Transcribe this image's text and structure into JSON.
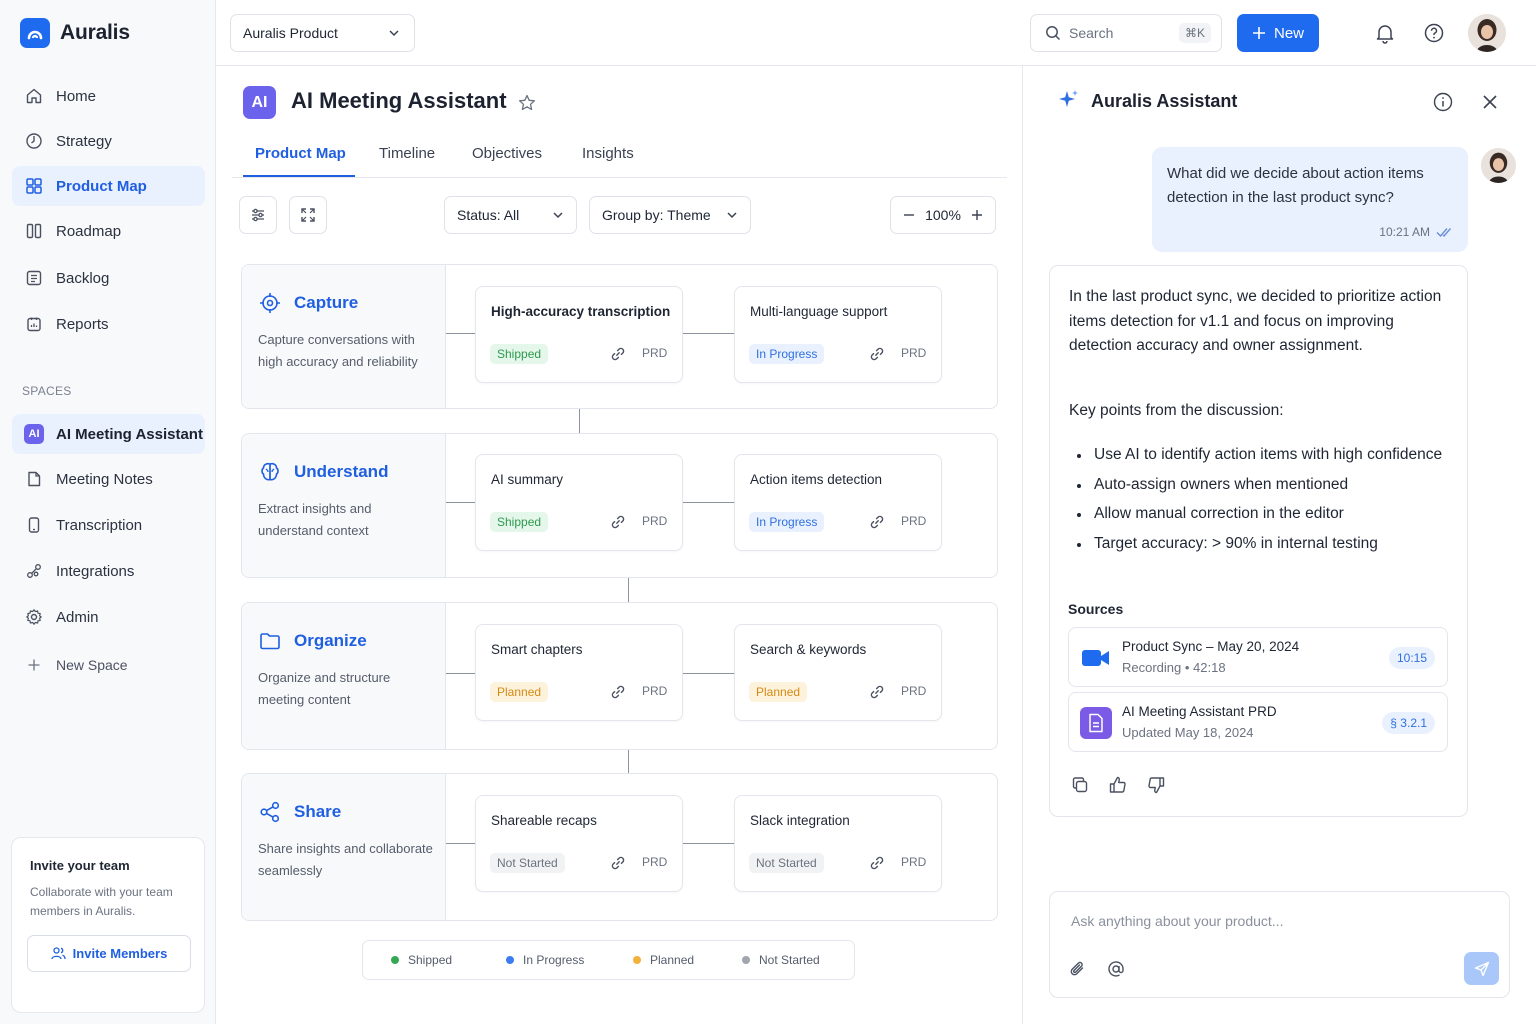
{
  "app": {
    "name": "Auralis"
  },
  "sidebar": {
    "nav": [
      {
        "label": "Home",
        "icon": "home-icon"
      },
      {
        "label": "Strategy",
        "icon": "strategy-icon"
      },
      {
        "label": "Product Map",
        "icon": "product-map-icon",
        "active": true
      },
      {
        "label": "Roadmap",
        "icon": "roadmap-icon"
      },
      {
        "label": "Backlog",
        "icon": "backlog-icon"
      },
      {
        "label": "Reports",
        "icon": "reports-icon"
      }
    ],
    "spaces_title": "SPACES",
    "spaces": [
      {
        "label": "AI Meeting Assistant",
        "badge": "AI",
        "active": true
      },
      {
        "label": "Meeting Notes",
        "icon": "document-icon"
      },
      {
        "label": "Transcription",
        "icon": "phone-icon"
      },
      {
        "label": "Integrations",
        "icon": "integrations-icon"
      },
      {
        "label": "Admin",
        "icon": "gear-icon"
      },
      {
        "label": "New Space",
        "icon": "plus-icon"
      }
    ],
    "invite": {
      "title": "Invite your team",
      "description": "Collaborate with your team members in Auralis.",
      "button": "Invite Members"
    }
  },
  "topbar": {
    "product_select": "Auralis Product",
    "search_placeholder": "Search",
    "search_shortcut": "⌘K",
    "new_button": "New"
  },
  "page": {
    "badge": "AI",
    "title": "AI Meeting Assistant",
    "tabs": [
      "Product Map",
      "Timeline",
      "Objectives",
      "Insights"
    ],
    "filters": {
      "status": "Status: All",
      "group_by": "Group by: Theme",
      "zoom": "100%"
    }
  },
  "themes": [
    {
      "name": "Capture",
      "icon": "target-icon",
      "description": "Capture conversations with high accuracy and reliability",
      "features": [
        {
          "title": "High-accuracy transcription",
          "status": "Shipped",
          "doc": "PRD"
        },
        {
          "title": "Multi-language support",
          "status": "In Progress",
          "doc": "PRD"
        }
      ]
    },
    {
      "name": "Understand",
      "icon": "brain-icon",
      "description": "Extract insights and understand context",
      "features": [
        {
          "title": "AI summary",
          "status": "Shipped",
          "doc": "PRD"
        },
        {
          "title": "Action items detection",
          "status": "In Progress",
          "doc": "PRD"
        }
      ]
    },
    {
      "name": "Organize",
      "icon": "folder-icon",
      "description": "Organize and structure meeting content",
      "features": [
        {
          "title": "Smart chapters",
          "status": "Planned",
          "doc": "PRD"
        },
        {
          "title": "Search & keywords",
          "status": "Planned",
          "doc": "PRD"
        }
      ]
    },
    {
      "name": "Share",
      "icon": "share-icon",
      "description": "Share insights and collaborate seamlessly",
      "features": [
        {
          "title": "Shareable recaps",
          "status": "Not Started",
          "doc": "PRD"
        },
        {
          "title": "Slack integration",
          "status": "Not Started",
          "doc": "PRD"
        }
      ]
    }
  ],
  "legend": [
    {
      "label": "Shipped",
      "color": "#34a853"
    },
    {
      "label": "In Progress",
      "color": "#3b7cf0"
    },
    {
      "label": "Planned",
      "color": "#f2b13a"
    },
    {
      "label": "Not Started",
      "color": "#a0a5ae"
    }
  ],
  "assistant": {
    "title": "Auralis Assistant",
    "user_message": "What did we decide about action items detection in the last product sync?",
    "user_time": "10:21 AM",
    "answer_intro": "In the last product sync, we decided to prioritize action items detection for v1.1 and focus on improving detection accuracy and owner assignment.",
    "answer_heading": "Key points from the discussion:",
    "answer_points": [
      "Use AI to identify action items with high confidence",
      "Auto-assign owners when mentioned",
      "Allow manual correction in the editor",
      "Target accuracy: > 90% in internal testing"
    ],
    "sources_title": "Sources",
    "sources": [
      {
        "title": "Product Sync – May 20, 2024",
        "sub": "Recording • 42:18",
        "chip": "10:15",
        "icon": "video-icon"
      },
      {
        "title": "AI Meeting Assistant PRD",
        "sub": "Updated May 18, 2024",
        "chip": "§ 3.2.1",
        "icon": "document-icon"
      }
    ],
    "composer_placeholder": "Ask anything about your product..."
  },
  "colors": {
    "accent": "#1f6bf0",
    "space_badge": "#6b63ec"
  }
}
